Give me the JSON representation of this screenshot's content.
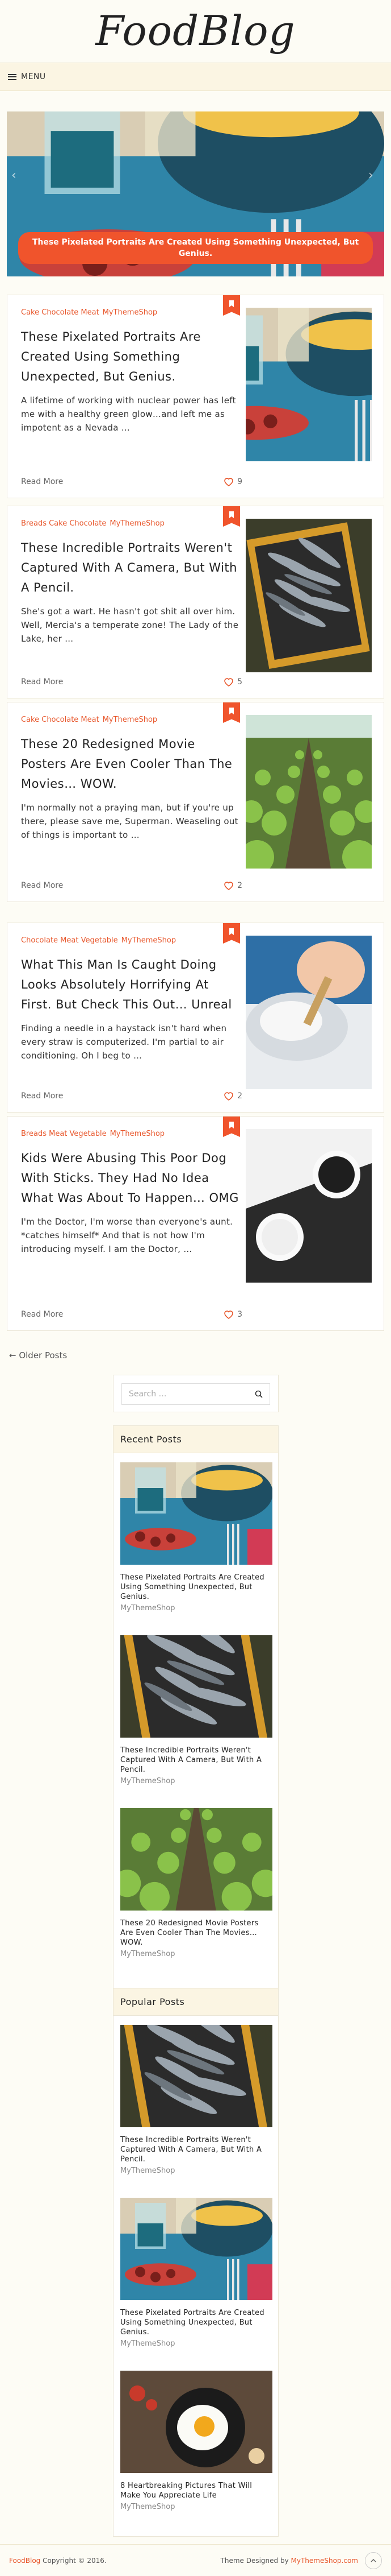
{
  "site": {
    "logo": "FoodBlog"
  },
  "nav": {
    "menu_label": "MENU"
  },
  "slider": {
    "caption": "These Pixelated Portraits Are Created Using Something Unexpected, But Genius."
  },
  "posts": [
    {
      "categories": "Cake Chocolate Meat",
      "author": "MyThemeShop",
      "title": "These Pixelated Portraits Are Created Using Something Unexpected, But Genius.",
      "excerpt": "A lifetime of working with nuclear power has left me with a healthy green glow…and left me as impotent as a Nevada …",
      "read_more": "Read More",
      "likes": "9",
      "thumb": "drinks"
    },
    {
      "categories": "Breads Cake Chocolate",
      "author": "MyThemeShop",
      "title": "These Incredible Portraits Weren't Captured With A Camera, But With A Pencil.",
      "excerpt": "She's got a wart. He hasn't got shit all over him. Well, Mercia's a temperate zone! The Lady of the Lake, her …",
      "read_more": "Read More",
      "likes": "5",
      "thumb": "fish"
    },
    {
      "categories": "Cake Chocolate Meat",
      "author": "MyThemeShop",
      "title": "These 20 Redesigned Movie Posters Are Even Cooler Than The Movies… WOW.",
      "excerpt": "I'm normally not a praying man, but if you're up there, please save me, Superman. Weaseling out of things is important to …",
      "read_more": "Read More",
      "likes": "2",
      "thumb": "field"
    },
    {
      "categories": "Chocolate Meat Vegetable",
      "author": "MyThemeShop",
      "title": "What This Man Is Caught Doing Looks Absolutely Horrifying At First. But Check This Out… Unreal",
      "excerpt": "Finding a needle in a haystack isn't hard when every straw is computerized. I'm partial to air conditioning. Oh I beg to …",
      "read_more": "Read More",
      "likes": "2",
      "thumb": "hand"
    },
    {
      "categories": "Breads Meat Vegetable",
      "author": "MyThemeShop",
      "title": "Kids Were Abusing This Poor Dog With Sticks. They Had No Idea What Was About To Happen… OMG",
      "excerpt": "I'm the Doctor, I'm worse than everyone's aunt. *catches himself* And that is not how I'm introducing myself. I am the Doctor, …",
      "read_more": "Read More",
      "likes": "3",
      "thumb": "cups"
    }
  ],
  "pagination": {
    "older": "← Older Posts"
  },
  "search": {
    "placeholder": "Search …"
  },
  "recent_posts": {
    "title": "Recent Posts",
    "items": [
      {
        "title": "These Pixelated Portraits Are Created Using Something Unexpected, But Genius.",
        "author": "MyThemeShop"
      },
      {
        "title": "These Incredible Portraits Weren't Captured With A Camera, But With A Pencil.",
        "author": "MyThemeShop"
      },
      {
        "title": "These 20 Redesigned Movie Posters Are Even Cooler Than The Movies… WOW.",
        "author": "MyThemeShop"
      }
    ]
  },
  "popular_posts": {
    "title": "Popular Posts",
    "items": [
      {
        "title": "These Incredible Portraits Weren't Captured With A Camera, But With A Pencil.",
        "author": "MyThemeShop"
      },
      {
        "title": "These Pixelated Portraits Are Created Using Something Unexpected, But Genius.",
        "author": "MyThemeShop"
      },
      {
        "title": "8 Heartbreaking Pictures That Will Make You Appreciate Life",
        "author": "MyThemeShop"
      }
    ]
  },
  "footer": {
    "brand": "FoodBlog",
    "copyright": "Copyright © 2016.",
    "designed_by_prefix": "Theme Designed by",
    "designed_by_link": "MyThemeShop.com",
    "to_top_icon": "chevron-up-icon"
  },
  "colors": {
    "accent": "#f0542c",
    "nav_bg": "#fbf5e3",
    "page_bg": "#fdfcf5"
  }
}
